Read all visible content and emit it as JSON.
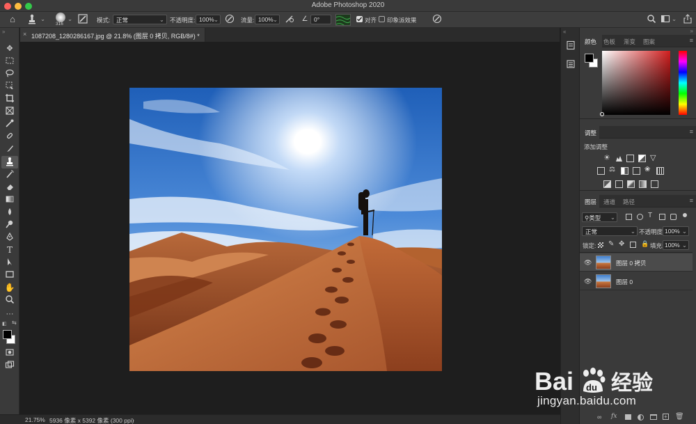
{
  "window": {
    "title": "Adobe Photoshop 2020"
  },
  "options_bar": {
    "brush_size": "316",
    "mode_label": "模式:",
    "mode_value": "正常",
    "opacity_label": "不透明度:",
    "opacity_value": "100%",
    "flow_label": "流量:",
    "flow_value": "100%",
    "angle_value": "0°",
    "align_label": "对齐",
    "align_checked": true,
    "sample_label": "印象派效果",
    "sample_checked": false
  },
  "document_tab": {
    "label": "1087208_1280286167.jpg @ 21.8% (图层 0 拷贝, RGB/8#) *"
  },
  "status_bar": {
    "zoom": "21.75%",
    "doc_info": "5936 像素 x 5392 像素 (300 ppi)"
  },
  "color_panel": {
    "tabs": [
      "颜色",
      "色板",
      "渐变",
      "图案"
    ],
    "active_tab": 0,
    "foreground": "#000000",
    "background": "#ffffff"
  },
  "adjustments_panel": {
    "tab": "调整",
    "add_label": "添加调整"
  },
  "layers_panel": {
    "tabs": [
      "图层",
      "通道",
      "路径"
    ],
    "active_tab": 0,
    "filter_label": "类型",
    "blend_mode": "正常",
    "opacity_label": "不透明度:",
    "opacity_value": "100%",
    "lock_label": "锁定:",
    "fill_label": "填充:",
    "fill_value": "100%",
    "layers": [
      {
        "name": "图层 0 拷贝",
        "selected": true,
        "visible": true
      },
      {
        "name": "图层 0",
        "selected": false,
        "visible": true
      }
    ]
  },
  "watermark": {
    "logo_text": "Baidu经验",
    "url": "jingyan.baidu.com"
  },
  "colors": {
    "app_bg": "#1e1e1e",
    "panel_bg": "#3a3a3a",
    "accent_selected_layer": "#4b4b4b"
  }
}
